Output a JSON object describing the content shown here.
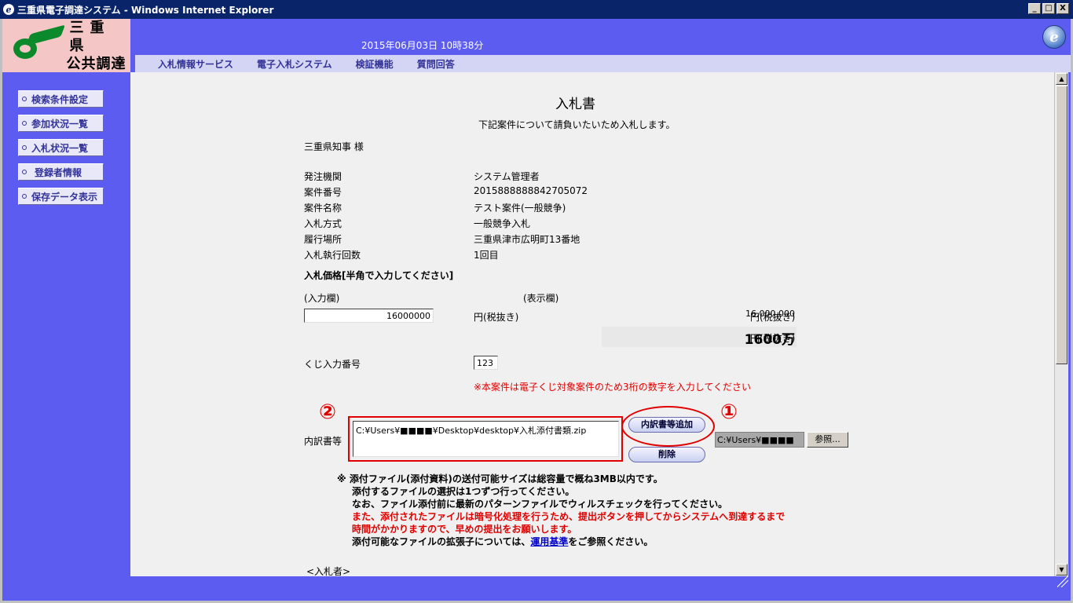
{
  "window": {
    "title": "三重県電子調達システム - Windows Internet Explorer",
    "btn_min": "_",
    "btn_max": "□",
    "btn_close": "X"
  },
  "logo": {
    "line1": "三重県",
    "line2": "公共調達"
  },
  "header": {
    "datetime": "2015年06月03日 10時38分",
    "nav": [
      "入札情報サービス",
      "電子入札システム",
      "検証機能",
      "質問回答"
    ]
  },
  "sidebar": {
    "items": [
      "検索条件設定",
      "参加状況一覧",
      "入札状況一覧",
      "登録者情報",
      "保存データ表示"
    ]
  },
  "doc": {
    "title": "入札書",
    "subtitle": "下記案件について請負いたいため入札します。",
    "addressee": "三重県知事 様",
    "rows": [
      {
        "label": "発注機関",
        "value": "システム管理者"
      },
      {
        "label": "案件番号",
        "value": "2015888888842705072"
      },
      {
        "label": "案件名称",
        "value": "テスト案件(一般競争)"
      },
      {
        "label": "入札方式",
        "value": "一般競争入札"
      },
      {
        "label": "履行場所",
        "value": "三重県津市広明町13番地"
      },
      {
        "label": "入札執行回数",
        "value": "1回目"
      }
    ],
    "price_label": "入札価格[半角で入力してください]",
    "input_col_label": "(入力欄)",
    "display_col_label": "(表示欄)",
    "price_input": "16000000",
    "unit": "円(税抜き)",
    "price_display": "16,000,000",
    "price_display_man": "1600万",
    "lottery_label": "くじ入力番号",
    "lottery_value": "123",
    "lottery_note": "※本案件は電子くじ対象案件のため3桁の数字を入力してください"
  },
  "attach": {
    "label": "内訳書等",
    "file": "C:¥Users¥■■■■¥Desktop¥desktop¥入札添付書類.zip",
    "add_button": "内訳書等追加",
    "delete_button": "削除",
    "path_value": "C:¥Users¥■■■■",
    "browse_button": "参照...",
    "marker1": "①",
    "marker2": "②"
  },
  "notes": {
    "line1": "※ 添付ファイル(添付資料)の送付可能サイズは総容量で概ね3MB以内です。",
    "line2": "添付するファイルの選択は1つずつ行ってください。",
    "line3": "なお、ファイル添付前に最新のパターンファイルでウィルスチェックを行ってください。",
    "line4": "また、添付されたファイルは暗号化処理を行うため、提出ボタンを押してからシステムへ到達するまで",
    "line5": "時間がかかりますので、早めの提出をお願いします。",
    "line6_pre": "添付可能なファイルの拡張子については、",
    "line6_link": "運用基準",
    "line6_post": "をご参照ください。"
  },
  "bidder": "<入札者>",
  "colors": {
    "frame": "#5c5cf0",
    "nav_bg": "#d4d4f4",
    "logo_bg": "#f4c6c6",
    "alert": "#e00000"
  }
}
